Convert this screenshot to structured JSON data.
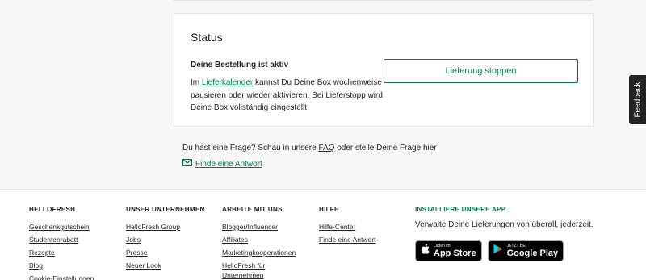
{
  "status": {
    "title": "Status",
    "heading": "Deine Bestellung ist aktiv",
    "text_before": "Im ",
    "link": "Lieferkalender",
    "text_after": " kannst Du Deine Box wochenweise pausieren oder wieder aktivieren. Bei Lieferstopp wird Deine Box vollständig eingestellt.",
    "stop_button": "Lieferung stoppen"
  },
  "help": {
    "question_before": "Du hast eine Frage? Schau in unsere ",
    "faq_link": "FAQ",
    "question_after": " oder stelle Deine Frage hier",
    "answer_link": "Finde eine Antwort"
  },
  "feedback_tab": "Feedback",
  "footer": {
    "hellofresh": {
      "heading": "HELLOFRESH",
      "links": [
        "Geschenkgutschein",
        "Studentenrabatt",
        "Rezepte",
        "Blog",
        "Cookie-Einstellungen"
      ]
    },
    "unternehmen": {
      "heading": "UNSER UNTERNEHMEN",
      "links": [
        "HelloFresh Group",
        "Jobs",
        "Presse",
        "Neuer Look"
      ]
    },
    "arbeite": {
      "heading": "ARBEITE MIT UNS",
      "links": [
        "Blogger/Influencer",
        "Affiliates",
        "Marketingkooperationen",
        "HelloFresh für Unternehmen"
      ]
    },
    "hilfe": {
      "heading": "HILFE",
      "links": [
        "Hilfe-Center",
        "Finde eine Antwort"
      ]
    },
    "app": {
      "heading": "INSTALLIERE UNSERE APP",
      "text": "Verwalte Deine Lieferungen von überall, jederzeit.",
      "app_store_small": "Laden im",
      "app_store_big": "App Store",
      "google_small": "JETZT BEI",
      "google_big": "Google Play"
    }
  },
  "colors": {
    "accent": "#067a46",
    "text": "#242424",
    "background": "#f8f8f8"
  }
}
